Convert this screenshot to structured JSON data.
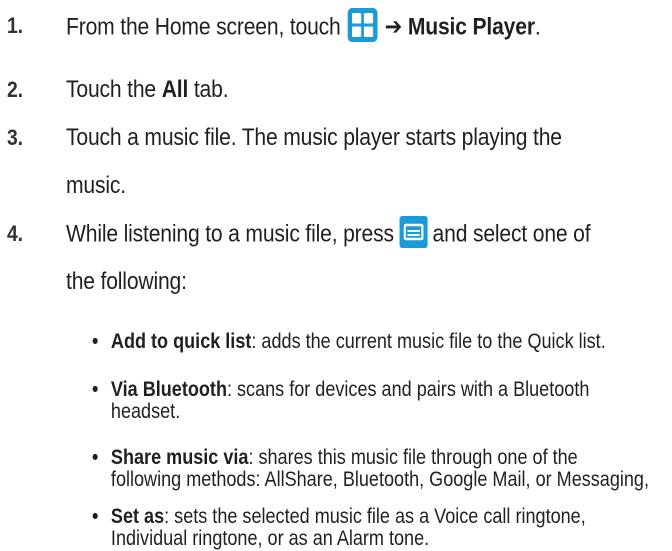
{
  "steps": [
    {
      "number": "1.",
      "text_before": "From the Home screen, touch",
      "arrow": "➔",
      "bold": "Music Player",
      "end": "."
    },
    {
      "number": "2.",
      "text_before": "Touch the",
      "bold": "All",
      "text_after": "tab."
    },
    {
      "number": "3.",
      "line1": "Touch a music file. The music player starts playing the",
      "line2": "music."
    },
    {
      "number": "4.",
      "line1_before": "While listening to a music file, press",
      "line1_after": "and select one of",
      "line2": "the following:"
    }
  ],
  "options": [
    {
      "term": "Add to quick list",
      "desc1": ": adds the current music file to the Quick list."
    },
    {
      "term": "Via Bluetooth",
      "desc1": ": scans for devices and pairs with a Bluetooth",
      "desc2": "headset."
    },
    {
      "term": "Share music via",
      "desc1": ": shares this music file through one of the",
      "desc2": "following methods: AllShare, Bluetooth, Google Mail, or Messaging,"
    },
    {
      "term": "Set as",
      "desc1": ": sets the selected music file as a Voice call ringtone,",
      "desc2": "Individual ringtone, or  as an Alarm tone."
    }
  ],
  "bullet_glyph": "•",
  "icons": {
    "apps": "apps-grid-icon",
    "menu": "menu-icon"
  },
  "colors": {
    "apps_icon_blue": "#1a9ad6",
    "menu_icon_blue": "#1a9ad6",
    "text": "#231f20"
  }
}
